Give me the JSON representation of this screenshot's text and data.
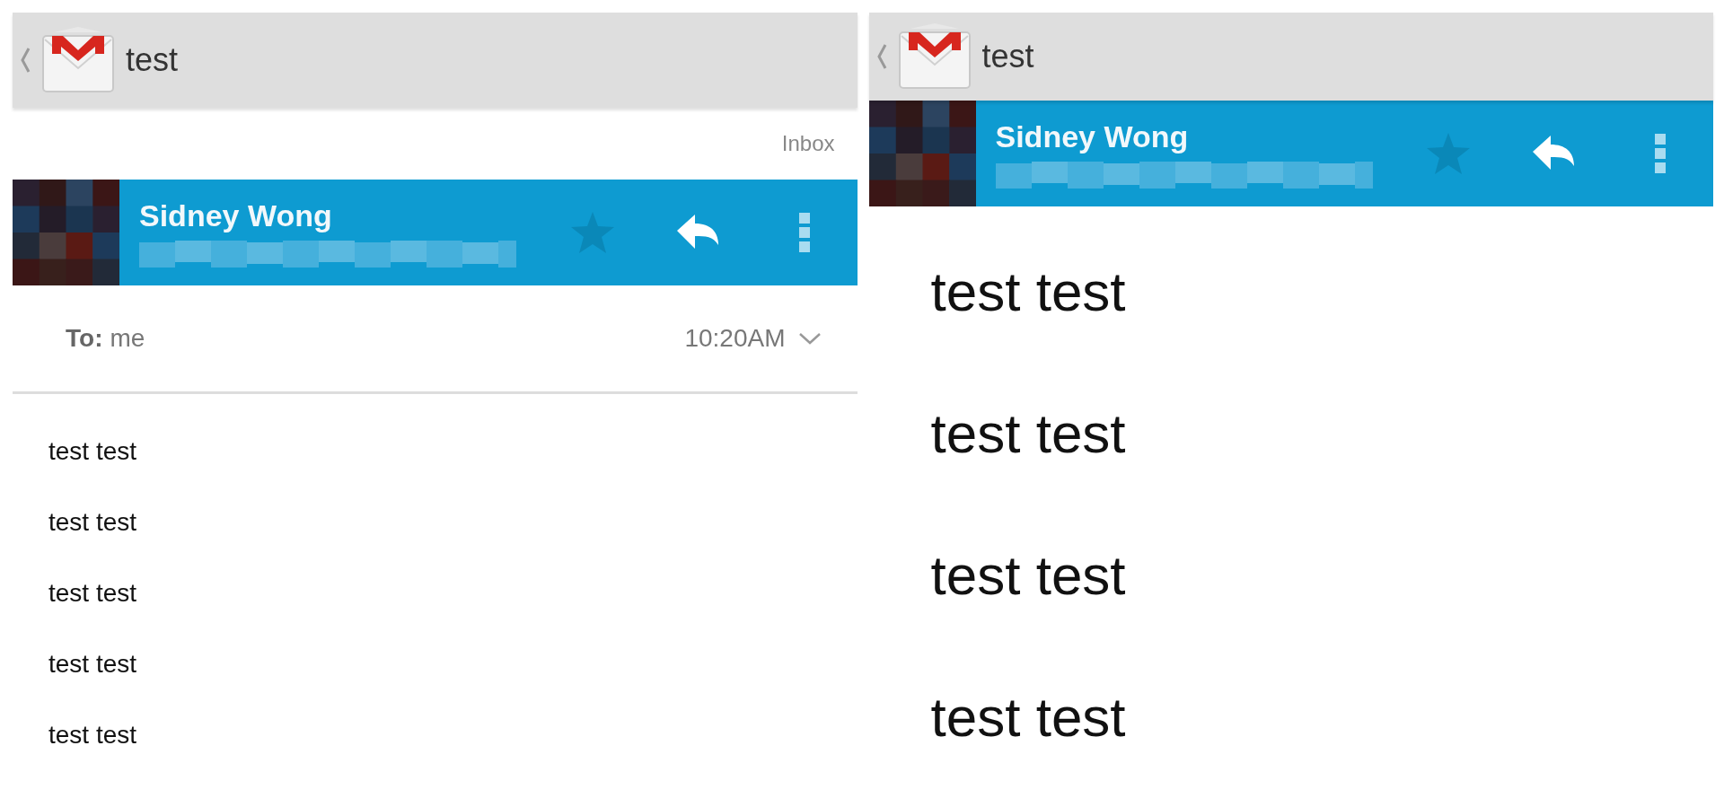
{
  "panels": [
    {
      "kind": "compact",
      "title": "test",
      "folder_label": "Inbox",
      "sender": {
        "name": "Sidney Wong"
      },
      "starred": false,
      "recipient": {
        "label": "To:",
        "value": "me"
      },
      "time": "10:20AM",
      "body": [
        "test test",
        "test test",
        "test test",
        "test test",
        "test test"
      ]
    },
    {
      "kind": "expanded",
      "title": "test",
      "sender": {
        "name": "Sidney Wong"
      },
      "starred": false,
      "body": [
        "test test",
        "test test",
        "test test",
        "test test"
      ]
    }
  ]
}
